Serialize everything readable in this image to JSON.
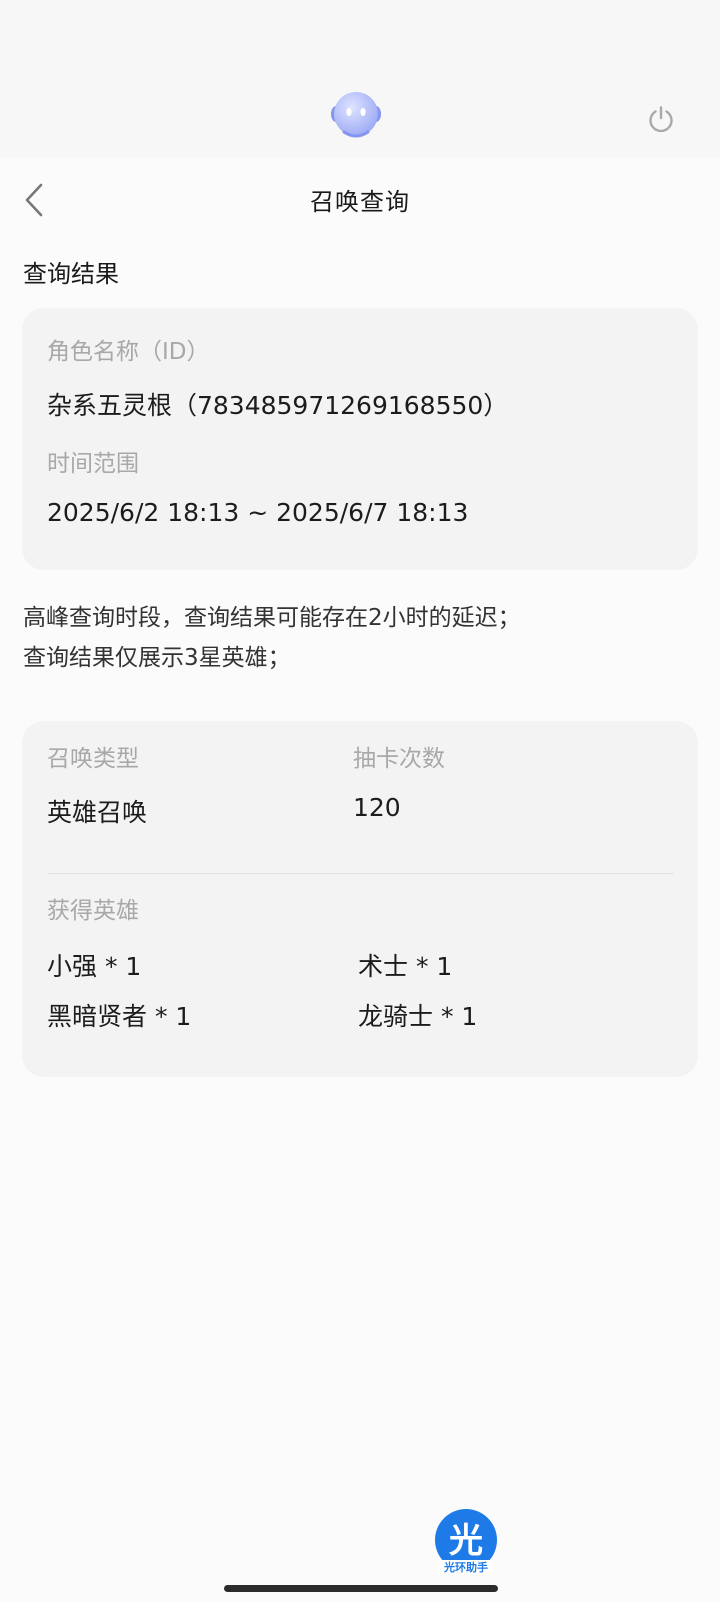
{
  "header": {
    "title": "召唤查询"
  },
  "result_section": {
    "title": "查询结果"
  },
  "info_card": {
    "role_label": "角色名称（ID）",
    "role_value": "杂系五灵根（783485971269168550）",
    "time_label": "时间范围",
    "time_value": "2025/6/2 18:13 ~ 2025/6/7 18:13"
  },
  "notices": [
    "高峰查询时段，查询结果可能存在2小时的延迟；",
    "查询结果仅展示3星英雄；"
  ],
  "result_card": {
    "summon_type_label": "召唤类型",
    "summon_type_value": "英雄召唤",
    "draw_count_label": "抽卡次数",
    "draw_count_value": "120",
    "heroes_label": "获得英雄",
    "heroes": [
      "小强 * 1",
      "术士 * 1",
      "黑暗贤者 * 1",
      "龙骑士 * 1"
    ]
  },
  "brand": {
    "logo_char": "光",
    "logo_text": "光环助手",
    "logo_color": "#1e7ae6"
  },
  "icons": {
    "back": "chevron-left-icon",
    "power": "power-icon",
    "assistant": "assistant-avatar-icon"
  },
  "colors": {
    "label": "#a8a8a8",
    "card_bg": "#f3f3f3",
    "avatar_accent": "#9aa8f5"
  }
}
